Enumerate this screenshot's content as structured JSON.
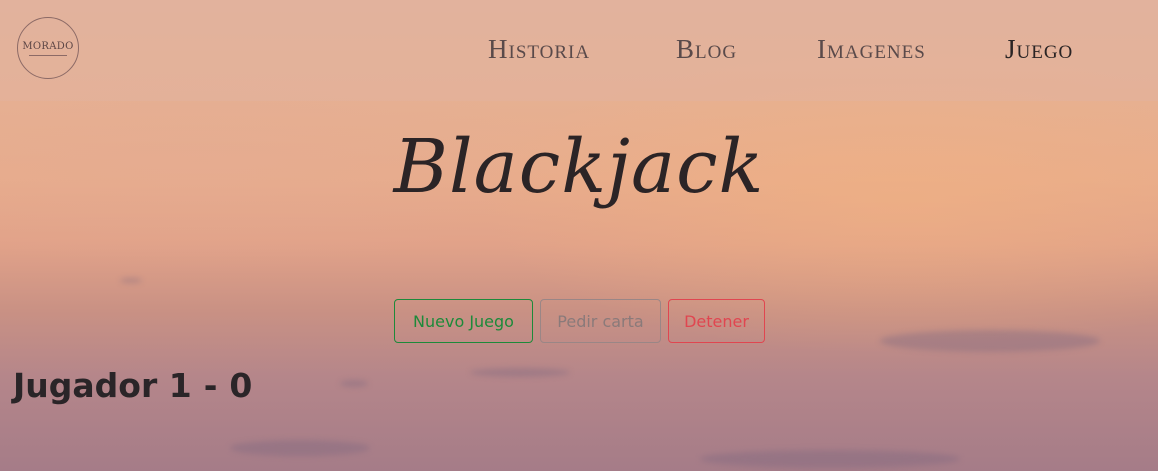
{
  "header": {
    "logo_text": "MORADO",
    "nav": [
      {
        "label": "Historia",
        "active": false
      },
      {
        "label": "Blog",
        "active": false
      },
      {
        "label": "Imagenes",
        "active": false
      },
      {
        "label": "Juego",
        "active": true
      }
    ]
  },
  "main": {
    "title": "Blackjack",
    "buttons": {
      "new_game": "Nuevo Juego",
      "hit": "Pedir carta",
      "stop": "Detener"
    },
    "player": {
      "name": "Jugador 1",
      "separator": "-",
      "score": "0"
    }
  },
  "colors": {
    "new_game": "#1d8a3a",
    "hit": "#8a7a7a",
    "stop": "#e04650"
  }
}
